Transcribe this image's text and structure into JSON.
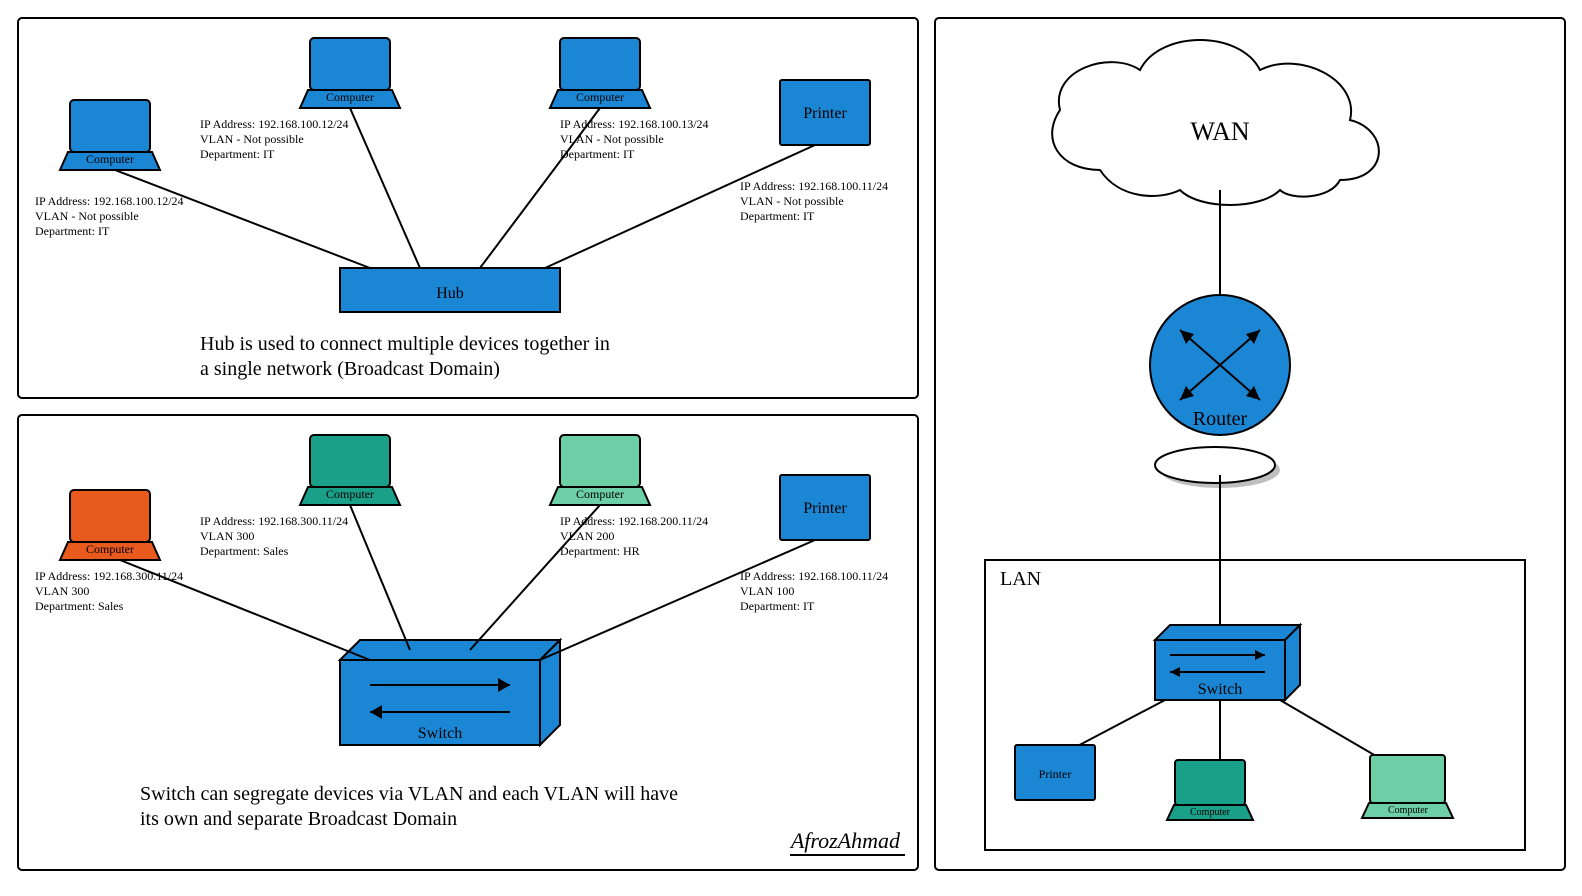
{
  "panel_hub": {
    "device_label": "Hub",
    "caption_line1": "Hub is used to connect multiple devices together in",
    "caption_line2": "a single network (Broadcast Domain)",
    "devices": {
      "pc1": {
        "name": "Computer",
        "ip": "IP Address: 192.168.100.12/24",
        "vlan": "VLAN - Not possible",
        "dept": "Department: IT"
      },
      "pc2": {
        "name": "Computer",
        "ip": "IP Address: 192.168.100.12/24",
        "vlan": "VLAN - Not possible",
        "dept": "Department: IT"
      },
      "pc3": {
        "name": "Computer",
        "ip": "IP Address: 192.168.100.13/24",
        "vlan": "VLAN - Not possible",
        "dept": "Department: IT"
      },
      "printer": {
        "name": "Printer",
        "ip": "IP Address: 192.168.100.11/24",
        "vlan": "VLAN - Not possible",
        "dept": "Department: IT"
      }
    }
  },
  "panel_switch": {
    "device_label": "Switch",
    "caption_line1": "Switch can segregate devices via VLAN and each VLAN will have",
    "caption_line2": "its own and separate Broadcast Domain",
    "devices": {
      "pc1": {
        "name": "Computer",
        "ip": "IP Address: 192.168.300.11/24",
        "vlan": "VLAN 300",
        "dept": "Department: Sales"
      },
      "pc2": {
        "name": "Computer",
        "ip": "IP Address: 192.168.300.11/24",
        "vlan": "VLAN 300",
        "dept": "Department: Sales"
      },
      "pc3": {
        "name": "Computer",
        "ip": "IP Address: 192.168.200.11/24",
        "vlan": "VLAN 200",
        "dept": "Department: HR"
      },
      "printer": {
        "name": "Printer",
        "ip": "IP Address: 192.168.100.11/24",
        "vlan": "VLAN 100",
        "dept": "Department: IT"
      }
    }
  },
  "panel_wan": {
    "wan_label": "WAN",
    "router_label": "Router",
    "lan_label": "LAN",
    "switch_label": "Switch",
    "printer_label": "Printer",
    "pc1_label": "Computer",
    "pc2_label": "Computer"
  },
  "author": "AfrozAhmad"
}
